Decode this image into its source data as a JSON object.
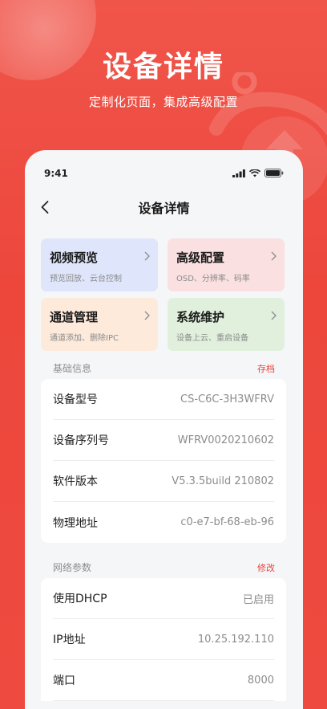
{
  "hero": {
    "title": "设备详情",
    "subtitle": "定制化页面，集成高级配置"
  },
  "status_bar": {
    "time": "9:41"
  },
  "nav": {
    "title": "设备详情"
  },
  "cards": [
    {
      "title": "视频预览",
      "subtitle": "预览回放、云台控制",
      "color": "#dfe6fb"
    },
    {
      "title": "高级配置",
      "subtitle": "OSD、分辨率、码率",
      "color": "#fbe0e1"
    },
    {
      "title": "通道管理",
      "subtitle": "通道添加、删除IPC",
      "color": "#fdeadb"
    },
    {
      "title": "系统维护",
      "subtitle": "设备上云、重启设备",
      "color": "#e0f0dc"
    }
  ],
  "basic_info": {
    "label": "基础信息",
    "action": "存档",
    "rows": [
      {
        "label": "设备型号",
        "value": "CS-C6C-3H3WFRV"
      },
      {
        "label": "设备序列号",
        "value": "WFRV0020210602"
      },
      {
        "label": "软件版本",
        "value": "V5.3.5build 210802"
      },
      {
        "label": "物理地址",
        "value": "c0-e7-bf-68-eb-96"
      }
    ]
  },
  "network": {
    "label": "网络参数",
    "action": "修改",
    "rows": [
      {
        "label": "使用DHCP",
        "value": "已启用"
      },
      {
        "label": "IP地址",
        "value": "10.25.192.110"
      },
      {
        "label": "端口",
        "value": "8000"
      }
    ]
  },
  "colors": {
    "brand_red": "#ee4a3e",
    "accent_text": "#e8453c"
  }
}
